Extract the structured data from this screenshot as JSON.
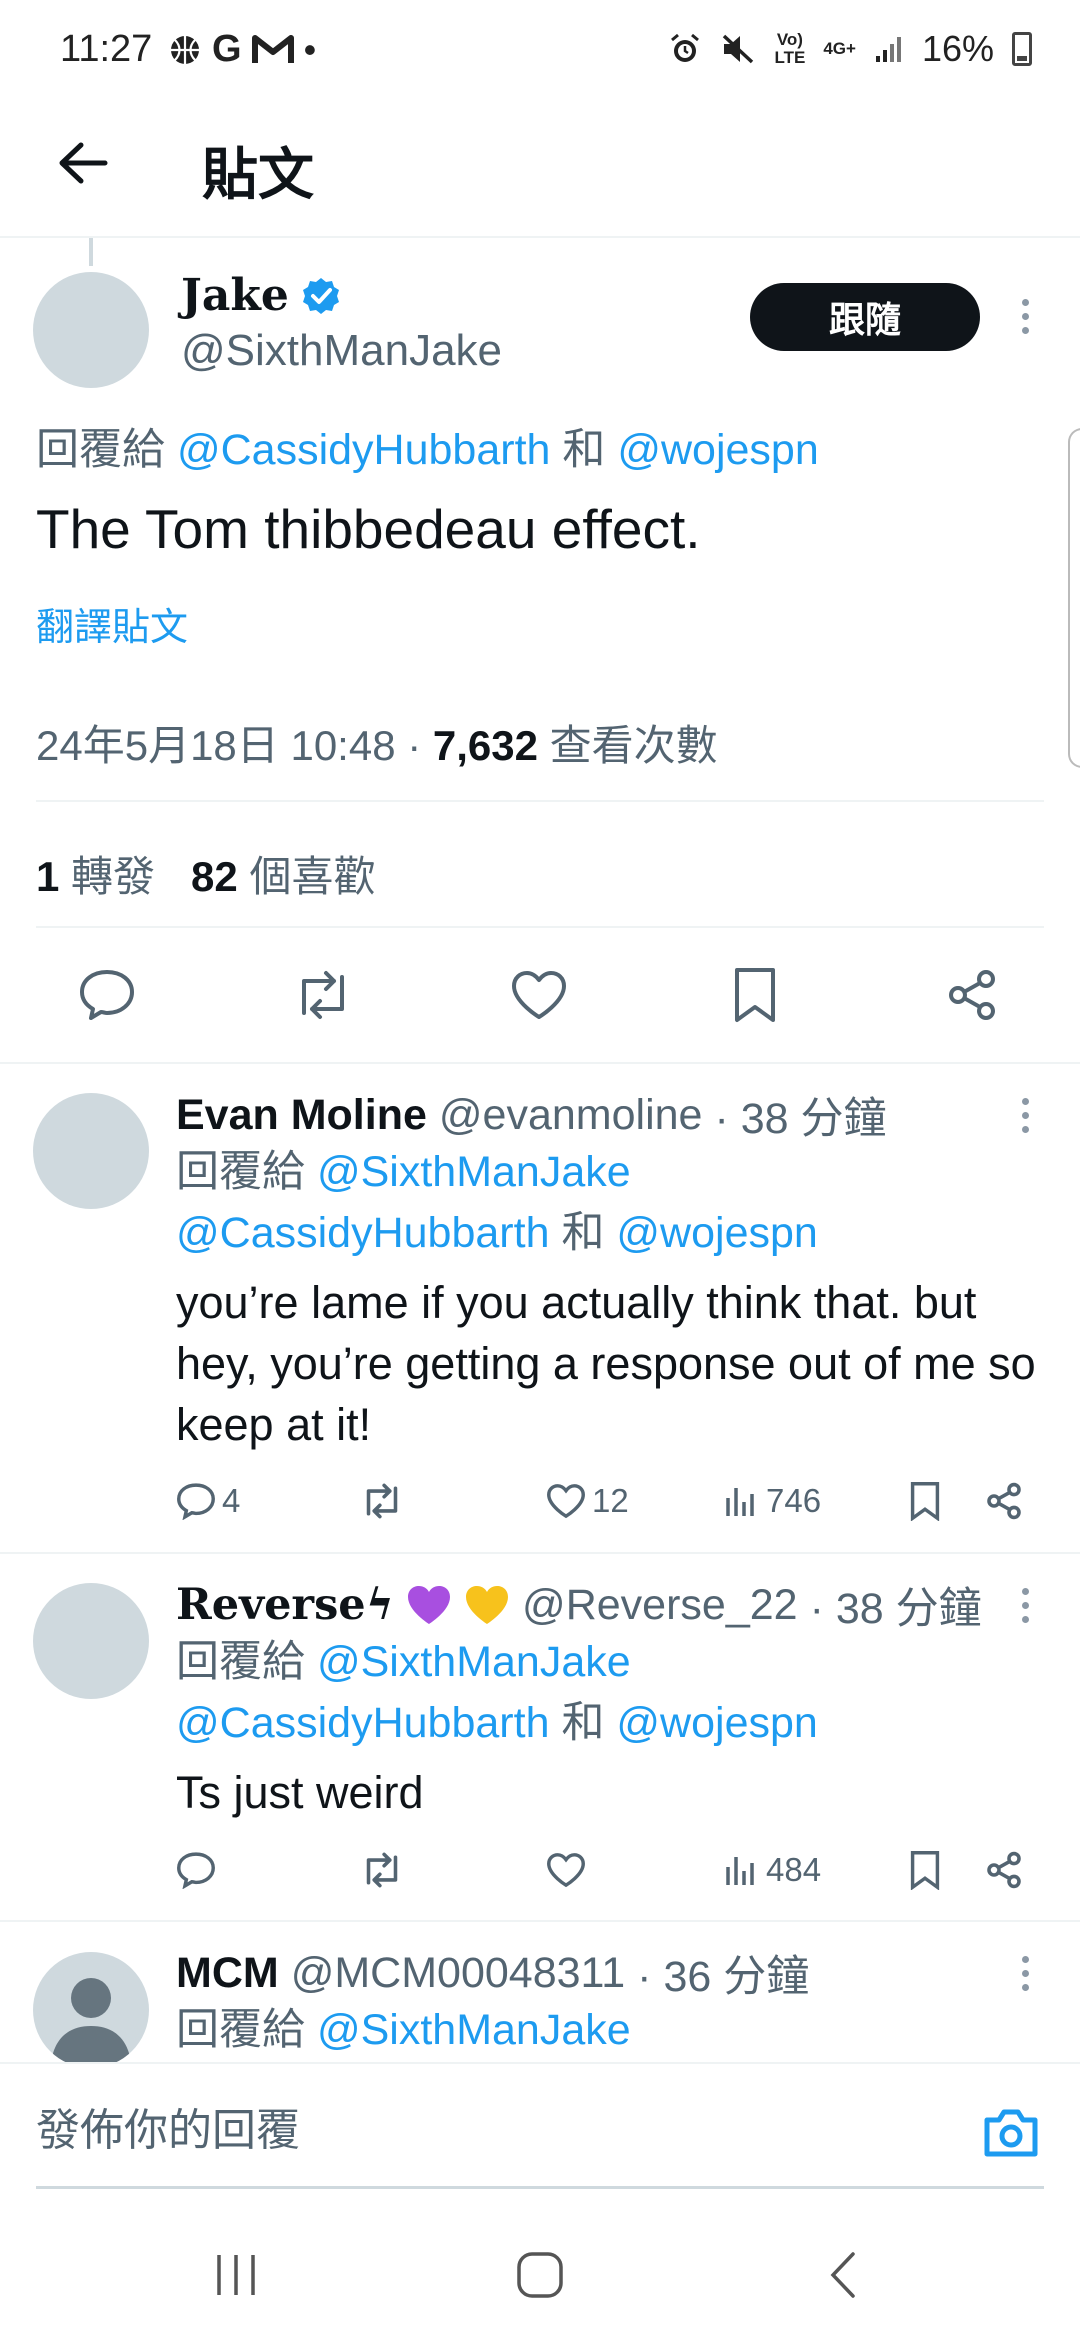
{
  "status_bar": {
    "time": "11:27",
    "left_icons": [
      "basketball-icon",
      "G",
      "gmail-icon",
      "•"
    ],
    "volte": "Vo)\nLTE",
    "network": "4G+",
    "battery": "16%"
  },
  "header": {
    "title": "貼文"
  },
  "tweet": {
    "name": "Jake",
    "handle": "@SixthManJake",
    "follow_label": "跟隨",
    "reply_prefix": "回覆給",
    "mention1": "@CassidyHubbarth",
    "conj": "和",
    "mention2": "@wojespn",
    "text": "The Tom thibbedeau effect.",
    "translate": "翻譯貼文",
    "datetime": "24年5月18日 10:48 · ",
    "views": "7,632",
    "views_label": " 查看次數",
    "retweets": "1",
    "retweets_label": "轉發",
    "likes": "82",
    "likes_label": "個喜歡"
  },
  "replies": [
    {
      "name": "Evan Moline",
      "handle": "@evanmoline",
      "time": "· 38 分鐘",
      "reply_prefix": "回覆給",
      "mention0": "@SixthManJake",
      "mention1": "@CassidyHubbarth",
      "conj": "和",
      "mention2": "@wojespn",
      "text": "you’re lame if you actually think that. but hey, you’re getting a response out of me so keep at it!",
      "replies_count": "4",
      "likes_count": "12",
      "views_count": "746"
    },
    {
      "name": "Reverse",
      "name_suffix": "ϟ",
      "handle": "@Reverse_22",
      "time": "· 38 分鐘",
      "reply_prefix": "回覆給",
      "mention0": "@SixthManJake",
      "mention1": "@CassidyHubbarth",
      "conj": "和",
      "mention2": "@wojespn",
      "text": "Ts just weird",
      "views_count": "484"
    },
    {
      "name": "MCM",
      "handle": "@MCM00048311",
      "time": "· 36 分鐘",
      "reply_prefix": "回覆給",
      "mention0": "@SixthManJake"
    }
  ],
  "composer": {
    "placeholder": "發佈你的回覆"
  },
  "colors": {
    "accent": "#1d9bf0",
    "text": "#0f1419",
    "muted": "#536471"
  }
}
